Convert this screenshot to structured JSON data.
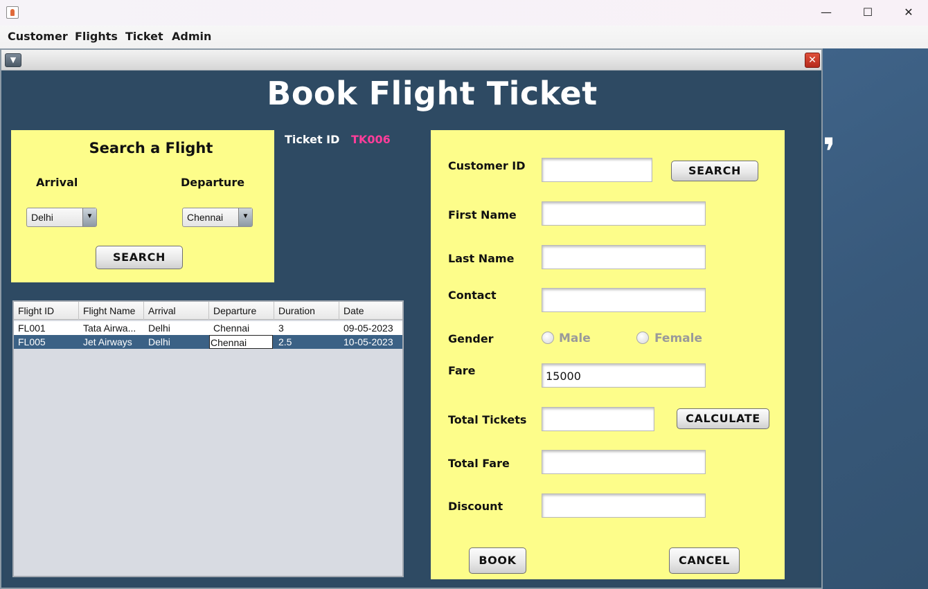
{
  "menubar": {
    "items": [
      "Customer",
      "Flights",
      "Ticket",
      "Admin"
    ]
  },
  "window_controls": {
    "minimize": "—",
    "maximize": "☐",
    "close": "✕"
  },
  "frame": {
    "title": "Book Flight Ticket"
  },
  "search_panel": {
    "title": "Search a Flight",
    "arrival_label": "Arrival",
    "departure_label": "Departure",
    "arrival_value": "Delhi",
    "departure_value": "Chennai",
    "search_button": "SEARCH"
  },
  "ticket": {
    "label": "Ticket ID",
    "value": "TK006"
  },
  "flights_table": {
    "columns": [
      "Flight ID",
      "Flight Name",
      "Arrival",
      "Departure",
      "Duration",
      "Date"
    ],
    "rows": [
      [
        "FL001",
        "Tata Airwa...",
        "Delhi",
        "Chennai",
        "3",
        "09-05-2023"
      ],
      [
        "FL005",
        "Jet Airways",
        "Delhi",
        "Chennai",
        "2.5",
        "10-05-2023"
      ]
    ]
  },
  "customer_panel": {
    "customer_id_label": "Customer ID",
    "customer_id_value": "",
    "search_button": "SEARCH",
    "first_name_label": "First Name",
    "first_name_value": "",
    "last_name_label": "Last Name",
    "last_name_value": "",
    "contact_label": "Contact",
    "contact_value": "",
    "gender_label": "Gender",
    "gender_options": [
      "Male",
      "Female"
    ],
    "fare_label": "Fare",
    "fare_value": "15000",
    "total_tickets_label": "Total Tickets",
    "total_tickets_value": "",
    "calculate_button": "CALCULATE",
    "total_fare_label": "Total Fare",
    "total_fare_value": "",
    "discount_label": "Discount",
    "discount_value": "",
    "book_button": "BOOK",
    "cancel_button": "CANCEL"
  }
}
